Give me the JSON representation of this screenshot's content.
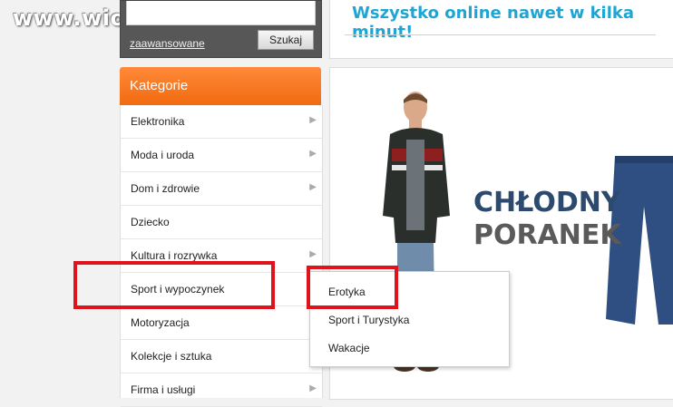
{
  "watermark": "www.wiocha.pl",
  "search": {
    "advanced_link": "zaawansowane",
    "button": "Szukaj"
  },
  "promo": {
    "text": "Wszystko online nawet w kilka minut!"
  },
  "categories": {
    "header": "Kategorie",
    "items": [
      {
        "label": "Elektronika",
        "arrow": true
      },
      {
        "label": "Moda i uroda",
        "arrow": true
      },
      {
        "label": "Dom i zdrowie",
        "arrow": true
      },
      {
        "label": "Dziecko",
        "arrow": false
      },
      {
        "label": "Kultura i rozrywka",
        "arrow": true
      },
      {
        "label": "Sport i wypoczynek",
        "arrow": false
      },
      {
        "label": "Motoryzacja",
        "arrow": false
      },
      {
        "label": "Kolekcje i sztuka",
        "arrow": true
      },
      {
        "label": "Firma i usługi",
        "arrow": true
      }
    ]
  },
  "submenu": {
    "items": [
      "Erotyka",
      "Sport i Turystyka",
      "Wakacje"
    ]
  },
  "hero": {
    "line1": "CHŁODNY",
    "line2": "PORANEK"
  },
  "colors": {
    "accent": "#f26a10",
    "highlight": "#e0121b",
    "promo_text": "#1fa5d4"
  }
}
